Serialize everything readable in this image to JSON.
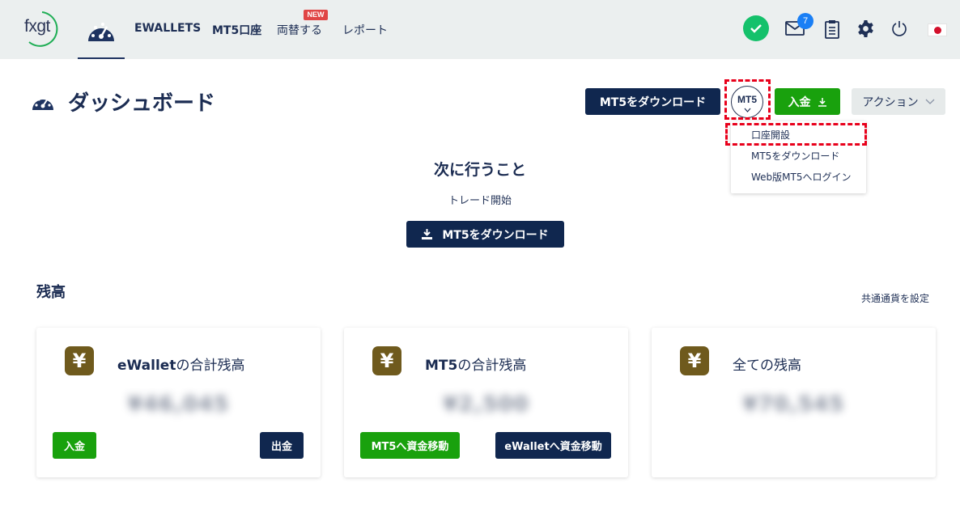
{
  "topbar": {
    "logo_text": "fxgt",
    "nav": [
      "EWALLETS",
      "MT5口座",
      "両替する",
      "レポート"
    ],
    "new_badge": "NEW",
    "mail_count": "7",
    "icons": [
      "dashboard-icon",
      "check-icon",
      "mail-icon",
      "clipboard-icon",
      "gear-icon",
      "power-icon",
      "japan-flag-icon"
    ]
  },
  "page": {
    "title": "ダッシュボード",
    "buttons": {
      "download_mt5": "MT5をダウンロード",
      "mt5_menu": "MT5",
      "deposit": "入金",
      "actions": "アクション"
    },
    "mt5_dropdown": [
      "口座開設",
      "MT5をダウンロード",
      "Web版MT5へログイン"
    ]
  },
  "next_steps": {
    "title": "次に行うこと",
    "subtitle": "トレード開始",
    "button": "MT5をダウンロード"
  },
  "balances": {
    "title": "残高",
    "set_currency": "共通通貨を設定",
    "cards": [
      {
        "title_prefix": "eWallet",
        "title_suffix": "の合計残高",
        "amount": "¥46,045",
        "btn_left": "入金",
        "btn_right": "出金"
      },
      {
        "title_prefix": "MT5",
        "title_suffix": "の合計残高",
        "amount": "¥2,500",
        "btn_left": "MT5へ資金移動",
        "btn_right": "eWalletへ資金移動"
      },
      {
        "title_prefix": "",
        "title_suffix": "全ての残高",
        "amount": "¥70,545"
      }
    ]
  },
  "colors": {
    "navy": "#10274f",
    "green": "#19a10d",
    "yen_badge": "#6f5a1d",
    "topbar_bg": "#ebefef",
    "highlight": "#e8001b"
  }
}
